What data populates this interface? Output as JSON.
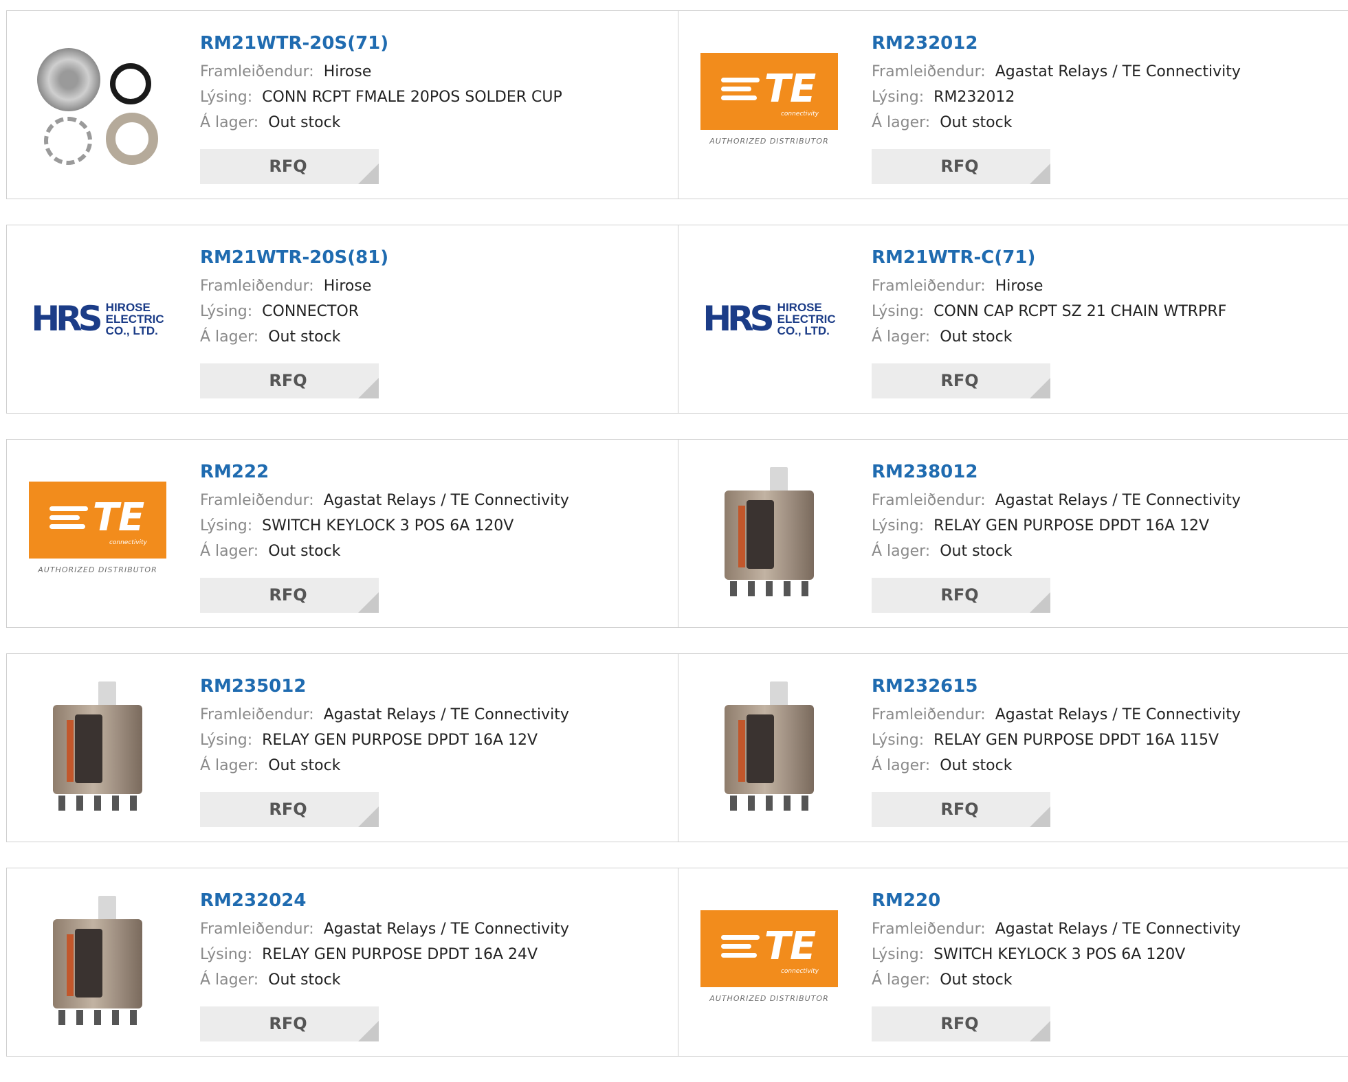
{
  "labels": {
    "manufacturer": "Framleiðendur:",
    "description": "Lýsing:",
    "stock": "Á lager:",
    "rfq": "RFQ",
    "te_logo": "TE",
    "te_logo_sub": "connectivity",
    "te_distributor": "AUTHORIZED DISTRIBUTOR",
    "hrs_mark": "HRS",
    "hrs_line1": "HIROSE",
    "hrs_line2": "ELECTRIC",
    "hrs_line3": "CO., LTD."
  },
  "colors": {
    "link": "#1f6bb0",
    "te_orange": "#f28c1c",
    "hrs_blue": "#1b3c87"
  },
  "products": [
    {
      "part": "RM21WTR-20S(71)",
      "manufacturer": "Hirose",
      "description": "CONN RCPT FMALE 20POS SOLDER CUP",
      "stock": "Out stock",
      "image": "connector-photo"
    },
    {
      "part": "RM232012",
      "manufacturer": "Agastat Relays / TE Connectivity",
      "description": "RM232012",
      "stock": "Out stock",
      "image": "te-logo"
    },
    {
      "part": "RM21WTR-20S(81)",
      "manufacturer": "Hirose",
      "description": "CONNECTOR",
      "stock": "Out stock",
      "image": "hrs-logo"
    },
    {
      "part": "RM21WTR-C(71)",
      "manufacturer": "Hirose",
      "description": "CONN CAP RCPT SZ 21 CHAIN WTRPRF",
      "stock": "Out stock",
      "image": "hrs-logo"
    },
    {
      "part": "RM222",
      "manufacturer": "Agastat Relays / TE Connectivity",
      "description": "SWITCH KEYLOCK 3 POS 6A 120V",
      "stock": "Out stock",
      "image": "te-logo"
    },
    {
      "part": "RM238012",
      "manufacturer": "Agastat Relays / TE Connectivity",
      "description": "RELAY GEN PURPOSE DPDT 16A 12V",
      "stock": "Out stock",
      "image": "relay-photo"
    },
    {
      "part": "RM235012",
      "manufacturer": "Agastat Relays / TE Connectivity",
      "description": "RELAY GEN PURPOSE DPDT 16A 12V",
      "stock": "Out stock",
      "image": "relay-photo"
    },
    {
      "part": "RM232615",
      "manufacturer": "Agastat Relays / TE Connectivity",
      "description": "RELAY GEN PURPOSE DPDT 16A 115V",
      "stock": "Out stock",
      "image": "relay-photo"
    },
    {
      "part": "RM232024",
      "manufacturer": "Agastat Relays / TE Connectivity",
      "description": "RELAY GEN PURPOSE DPDT 16A 24V",
      "stock": "Out stock",
      "image": "relay-photo"
    },
    {
      "part": "RM220",
      "manufacturer": "Agastat Relays / TE Connectivity",
      "description": "SWITCH KEYLOCK 3 POS 6A 120V",
      "stock": "Out stock",
      "image": "te-logo"
    }
  ]
}
